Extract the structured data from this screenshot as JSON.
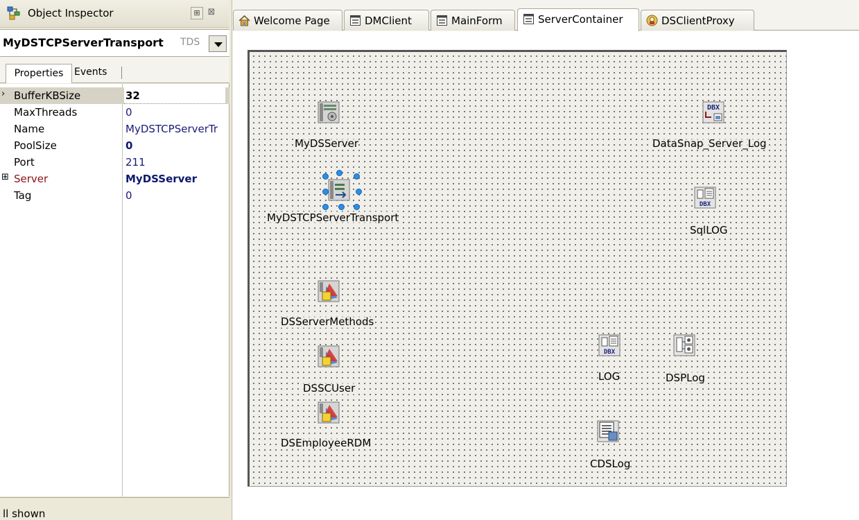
{
  "object_inspector": {
    "title": "Object Inspector",
    "pin_icon": "pin-icon",
    "close_icon": "close-icon",
    "selected_object": "MyDSTCPServerTransport",
    "selected_class": "TDS",
    "tabs": {
      "properties": "Properties",
      "events": "Events"
    },
    "properties": [
      {
        "name": "BufferKBSize",
        "value": "32",
        "bold": true,
        "selected": true,
        "marker": "›"
      },
      {
        "name": "MaxThreads",
        "value": "0",
        "bold": false
      },
      {
        "name": "Name",
        "value": "MyDSTCPServerTr",
        "bold": false
      },
      {
        "name": "PoolSize",
        "value": "0",
        "bold": true
      },
      {
        "name": "Port",
        "value": "211",
        "bold": false
      },
      {
        "name": "Server",
        "value": "MyDSServer",
        "bold": true,
        "reference": true,
        "marker": "⊞"
      },
      {
        "name": "Tag",
        "value": "0",
        "bold": false
      }
    ],
    "status": "ll shown"
  },
  "editor_tabs": [
    {
      "label": "Welcome Page",
      "icon": "home-icon",
      "active": false
    },
    {
      "label": "DMClient",
      "icon": "form-icon",
      "active": false
    },
    {
      "label": "MainForm",
      "icon": "form-icon",
      "active": false
    },
    {
      "label": "ServerContainer",
      "icon": "form-icon",
      "active": true
    },
    {
      "label": "DSClientProxy",
      "icon": "unit-icon",
      "active": false
    }
  ],
  "components": {
    "ds_server": {
      "label": "MyDSServer",
      "icon": "server-component-icon"
    },
    "tcp_transport": {
      "label": "MyDSTCPServerTransport",
      "icon": "transport-component-icon"
    },
    "server_log": {
      "label": "DataSnap_Server_Log",
      "icon": "dbx-connection-icon",
      "icon_text": "DBX"
    },
    "sql_log": {
      "label": "SqlLOG",
      "icon": "dbx-query-icon",
      "icon_text": "DBX"
    },
    "server_methods": {
      "label": "DSServerMethods",
      "icon": "server-class-icon"
    },
    "sc_user": {
      "label": "DSSCUser",
      "icon": "server-class-icon"
    },
    "employee_rdm": {
      "label": "DSEmployeeRDM",
      "icon": "server-class-icon"
    },
    "log": {
      "label": "LOG",
      "icon": "dbx-query-icon",
      "icon_text": "DBX"
    },
    "dsp_log": {
      "label": "DSPLog",
      "icon": "dataset-provider-icon"
    },
    "cds_log": {
      "label": "CDSLog",
      "icon": "client-dataset-icon"
    }
  }
}
